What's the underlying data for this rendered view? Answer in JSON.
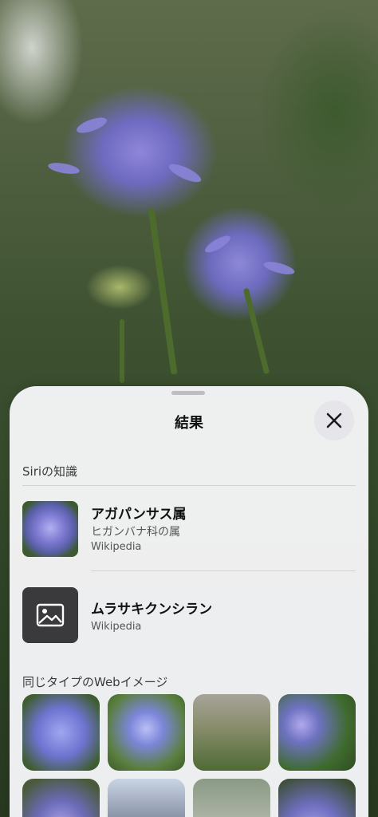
{
  "sheet": {
    "title": "結果",
    "close_icon": "close-icon"
  },
  "siri_knowledge": {
    "label": "Siriの知識",
    "results": [
      {
        "title": "アガパンサス属",
        "subtitle": "ヒガンバナ科の属",
        "source": "Wikipedia",
        "thumb": "flower-photo"
      },
      {
        "title": "ムラサキクンシラン",
        "source": "Wikipedia",
        "thumb": "image-placeholder-icon"
      }
    ]
  },
  "similar_images": {
    "label": "同じタイプのWebイメージ",
    "count_visible": 8
  }
}
